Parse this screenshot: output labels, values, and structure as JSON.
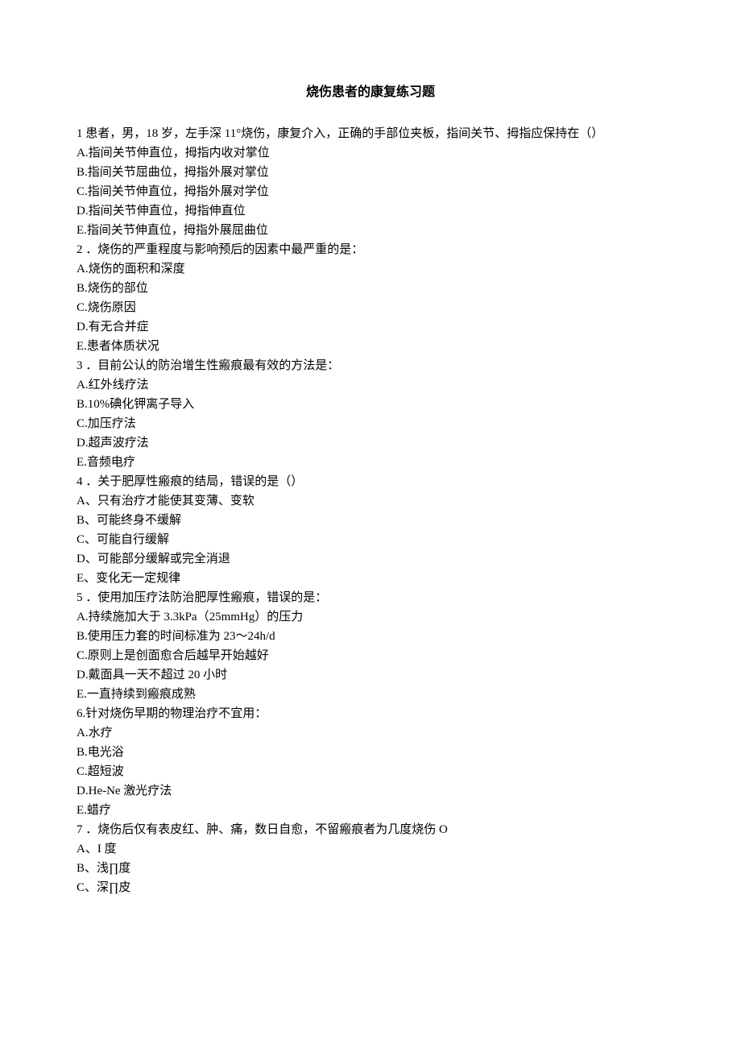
{
  "title": "烧伤患者的康复练习题",
  "questions": [
    {
      "stem": "1 患者，男，18 岁，左手深 11°烧伤，康复介入，正确的手部位夹板，指间关节、拇指应保持在（）",
      "options": [
        "A.指间关节伸直位，拇指内收对掌位",
        "B.指间关节屈曲位，拇指外展对掌位",
        "C.指间关节伸直位，拇指外展对学位",
        "D.指间关节伸直位，拇指伸直位",
        "E.指间关节伸直位，拇指外展屈曲位"
      ]
    },
    {
      "stem": "2 ．烧伤的严重程度与影响预后的因素中最严重的是：",
      "options": [
        "A.烧伤的面积和深度",
        "B.烧伤的部位",
        "C.烧伤原因",
        "D.有无合并症",
        "E.患者体质状况"
      ]
    },
    {
      "stem": "3 ．目前公认的防治增生性瘢痕最有效的方法是：",
      "options": [
        "A.红外线疗法",
        "B.10%碘化钾离子导入",
        "C.加压疗法",
        "D.超声波疗法",
        "E.音频电疗"
      ]
    },
    {
      "stem": "4 ．关于肥厚性瘢痕的结局，错误的是（）",
      "options": [
        "A、只有治疗才能使其变薄、变软",
        "B、可能终身不缓解",
        "C、可能自行缓解",
        "D、可能部分缓解或完全消退",
        "E、变化无一定规律"
      ]
    },
    {
      "stem": "5 ．使用加压疗法防治肥厚性瘢痕，错误的是：",
      "options": [
        "A.持续施加大于 3.3kPa（25mmHg）的压力",
        "B.使用压力套的时间标准为 23～24h/d",
        "C.原则上是创面愈合后越早开始越好",
        "D.戴面具一天不超过 20 小时",
        "E.一直持续到瘢痕成熟"
      ]
    },
    {
      "stem": "6.针对烧伤早期的物理治疗不宜用：",
      "options": [
        "A.水疗",
        "B.电光浴",
        "C.超短波",
        "D.He-Ne 激光疗法",
        "E.蜡疗"
      ]
    },
    {
      "stem": "7 ．烧伤后仅有表皮红、肿、痛，数日自愈，不留瘢痕者为几度烧伤 O",
      "options": [
        "A、I 度",
        "B、浅∏度",
        "C、深∏皮"
      ]
    }
  ]
}
